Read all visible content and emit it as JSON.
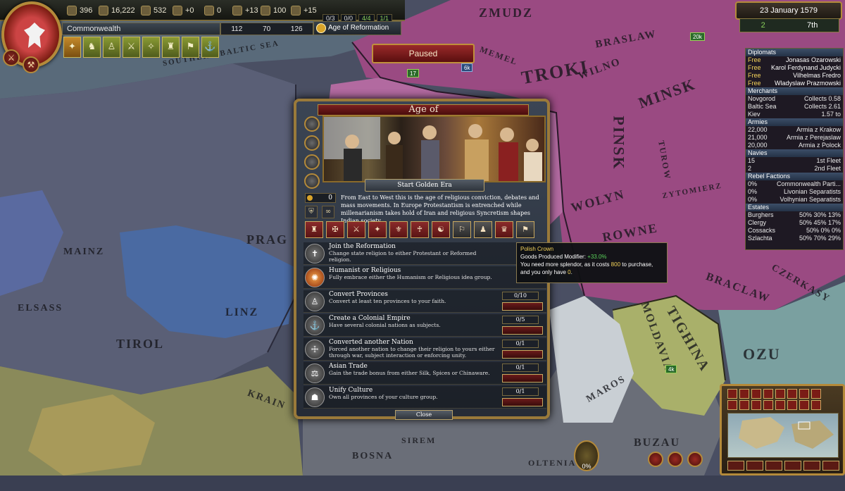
{
  "topbar": {
    "treasury": "396",
    "manpower": "16,222",
    "sailors": "532",
    "stability": "+0",
    "corruption": "0",
    "prestige": "+13",
    "legitimacy": "100",
    "power_projection": "+15",
    "counts": [
      "0/3",
      "0/0",
      "4/4",
      "1/1"
    ],
    "country_name": "Commonwealth",
    "adm": "112",
    "dip": "70",
    "mil": "126",
    "age": "Age of Reformation"
  },
  "paused": "Paused",
  "date": "23 January 1579",
  "rank": {
    "a": "2",
    "b": "7th"
  },
  "right_panel": {
    "diplomats_h": "Diplomats",
    "diplomats": [
      {
        "s": "Free",
        "n": "Jonasas Ozarowski"
      },
      {
        "s": "Free",
        "n": "Karol Ferdynand Judycki"
      },
      {
        "s": "Free",
        "n": "Vilhelmas Fredro"
      },
      {
        "s": "Free",
        "n": "Wladyslaw Prazmowski"
      }
    ],
    "merchants_h": "Merchants",
    "merchants": [
      {
        "a": "Novgorod",
        "b": "Collects 0.58"
      },
      {
        "a": "Baltic Sea",
        "b": "Collects 2.61"
      },
      {
        "a": "Kiev",
        "b": "1.57 to"
      }
    ],
    "armies_h": "Armies",
    "armies": [
      {
        "a": "22,000",
        "b": "Armia z Krakow"
      },
      {
        "a": "21,000",
        "b": "Armia z Perejaslaw"
      },
      {
        "a": "20,000",
        "b": "Armia z Polock"
      }
    ],
    "navies_h": "Navies",
    "navies": [
      {
        "a": "15",
        "b": "1st Fleet"
      },
      {
        "a": "2",
        "b": "2nd Fleet"
      }
    ],
    "rebels_h": "Rebel Factions",
    "rebels": [
      {
        "a": "0%",
        "b": "Commonwealth Parti..."
      },
      {
        "a": "0%",
        "b": "Livonian Separatists"
      },
      {
        "a": "0%",
        "b": "Volhynian Separatists"
      }
    ],
    "estates_h": "Estates",
    "estates": [
      {
        "a": "Burghers",
        "b": "50% 30% 13%"
      },
      {
        "a": "Clergy",
        "b": "50% 45% 17%"
      },
      {
        "a": "Cossacks",
        "b": "50% 0% 0%"
      },
      {
        "a": "Szlachta",
        "b": "50% 70% 29%"
      }
    ]
  },
  "dialog": {
    "title": "Age of Reformation",
    "start_label": "Start Golden Era",
    "splendor": "0",
    "description": "From East to West this is the age of religious conviction, debates and mass movements. In Europe Protestantism is entrenched while millenarianism takes hold of Iran and religious Syncretism shapes Indian society.",
    "objectives": [
      {
        "title": "Join the Reformation",
        "desc": "Change state religion to either Protestant or Reformed religion.",
        "progress": ""
      },
      {
        "title": "Humanist or Religious",
        "desc": "Fully embrace either the Humanism or Religious idea group.",
        "progress": ""
      },
      {
        "title": "Convert Provinces",
        "desc": "Convert at least ten provinces to your faith.",
        "progress": "0/10"
      },
      {
        "title": "Create a Colonial Empire",
        "desc": "Have several colonial nations as subjects.",
        "progress": "0/5"
      },
      {
        "title": "Converted another Nation",
        "desc": "Forced another nation to change their religion to yours either through war, subject interaction or enforcing unity.",
        "progress": "0/1"
      },
      {
        "title": "Asian Trade",
        "desc": "Gain the trade bonus from either Silk, Spices or Chinaware.",
        "progress": "0/1"
      },
      {
        "title": "Unify Culture",
        "desc": "Own all provinces of your culture group.",
        "progress": "0/1"
      }
    ],
    "close_label": "Close"
  },
  "tooltip": {
    "title": "Polish Crown",
    "line1_a": "Goods Produced Modifier: ",
    "line1_b": "+33.0%",
    "line2_a": "You need more splendor, as it costs ",
    "line2_b": "800",
    "line2_c": " to purchase, and you only have ",
    "line2_d": "0",
    "line2_e": "."
  },
  "map_labels": [
    "ZMUDZ",
    "BRASLAW",
    "MEMEL",
    "TROKI",
    "WILNO",
    "MINSK",
    "PINSK",
    "TUROW",
    "WOLYN",
    "ROWNE",
    "ZYTOMIERZ",
    "BRACLAW",
    "CZERKASY",
    "TIGHINA",
    "MOLDAVIA",
    "OZU",
    "SOUTHERN BALTIC SEA",
    "TIROL",
    "PRAG",
    "LINZ",
    "MAINZ",
    "ELSASS",
    "BOSNA",
    "BUZAU",
    "MAROS",
    "SIREM",
    "OLTENIA",
    "KRAIN"
  ],
  "units": [
    "17",
    "6k",
    "20k",
    "4k"
  ],
  "tech_pct": "0%"
}
